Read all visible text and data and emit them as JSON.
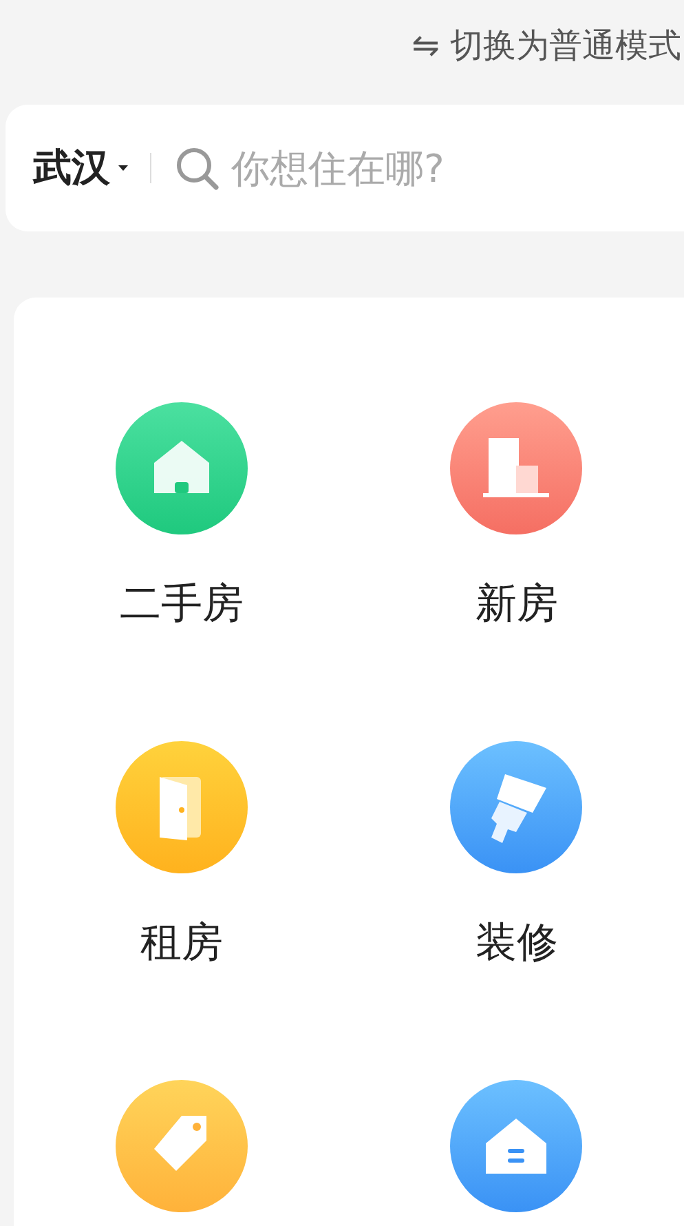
{
  "top_bar": {
    "mode_switch": {
      "icon": "⇋",
      "label": "切换为普通模式"
    }
  },
  "search": {
    "city": "武汉",
    "placeholder": "你想住在哪?"
  },
  "services": [
    {
      "kind": "house",
      "label": "二手房"
    },
    {
      "kind": "building",
      "label": "新房"
    },
    {
      "kind": "door",
      "label": "租房"
    },
    {
      "kind": "brush",
      "label": "装修"
    },
    {
      "kind": "tag"
    },
    {
      "kind": "home"
    }
  ]
}
